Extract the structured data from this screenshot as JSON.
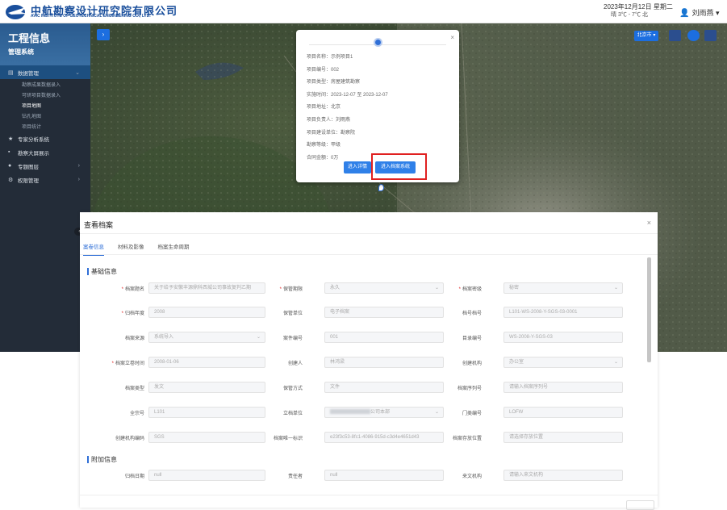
{
  "header": {
    "brand_cn": "中航勘察设计研究院有限公司",
    "brand_en": "AVIC INSTITUTE OF GEOTECHNICAL ENGINEERING CO., LTD.",
    "date": "2023年12月12日 星期二",
    "weather": "晴 3℃ - 7℃ 北",
    "user_name": "刘雨燕"
  },
  "sidebar": {
    "title": "工程信息",
    "subtitle": "管理系统",
    "items": [
      {
        "label": "数据管理",
        "type": "top",
        "active": true
      },
      {
        "label": "勘察成果数据录入",
        "type": "sub"
      },
      {
        "label": "可研项目数据录入",
        "type": "sub"
      },
      {
        "label": "项目地图",
        "type": "sub",
        "current": true
      },
      {
        "label": "钻孔地图",
        "type": "sub"
      },
      {
        "label": "项目统计",
        "type": "sub"
      },
      {
        "label": "专家分析系统",
        "type": "top"
      },
      {
        "label": "勘察大屏展示",
        "type": "top"
      },
      {
        "label": "专题图层",
        "type": "top",
        "arrow": true
      },
      {
        "label": "权限管理",
        "type": "top",
        "arrow": true
      }
    ]
  },
  "map": {
    "city_button": "北京市",
    "popup": {
      "rows": [
        "项目名称：示例项目1",
        "项目编号：002",
        "项目类型：房屋建筑勘察",
        "实施时间：2023-12-07 至 2023-12-07",
        "项目地址：北京",
        "项目负责人：刘雨燕",
        "项目建设单位：勘察院",
        "勘察等级：甲级",
        "合同金额：0万"
      ],
      "btn_portal": "进入详情",
      "btn_archive": "进入档案系统"
    }
  },
  "dialog": {
    "title": "查看档案",
    "tabs": [
      "案卷信息",
      "材料及影像",
      "档案生命周期"
    ],
    "section_basic": "基础信息",
    "section_extra": "附加信息",
    "fields": [
      {
        "label": "档案题名",
        "value": "关于给予安徽丰源鼎科西城公司事故复判乙期",
        "required": true,
        "col": 0,
        "row": 0
      },
      {
        "label": "保管期限",
        "value": "永久",
        "required": true,
        "col": 1,
        "row": 0,
        "dropdown": true
      },
      {
        "label": "档案密级",
        "value": "秘密",
        "required": true,
        "col": 2,
        "row": 0,
        "dropdown": true
      },
      {
        "label": "归档年度",
        "value": "2008",
        "required": true,
        "col": 0,
        "row": 1
      },
      {
        "label": "保管单位",
        "value": "电子档案",
        "col": 1,
        "row": 1
      },
      {
        "label": "档号档号",
        "value": "L101-WS-2008-Y-SGS-03-0001",
        "col": 2,
        "row": 1
      },
      {
        "label": "档案来源",
        "value": "系统导入",
        "col": 0,
        "row": 2,
        "dropdown": true
      },
      {
        "label": "案件编号",
        "value": "001",
        "col": 1,
        "row": 2
      },
      {
        "label": "目录编号",
        "value": "WS-2008-Y-SGS-03",
        "col": 2,
        "row": 2
      },
      {
        "label": "档案立卷时间",
        "value": "2008-01-06",
        "required": true,
        "col": 0,
        "row": 3
      },
      {
        "label": "创建人",
        "value": "林鸿梁",
        "col": 1,
        "row": 3
      },
      {
        "label": "创建机构",
        "value": "办公室",
        "col": 2,
        "row": 3,
        "dropdown": true
      },
      {
        "label": "档案类型",
        "value": "发文",
        "col": 0,
        "row": 4
      },
      {
        "label": "保管方式",
        "value": "文件",
        "col": 1,
        "row": 4
      },
      {
        "label": "档案序列号",
        "value": "请输入档案序列号",
        "col": 2,
        "row": 4
      },
      {
        "label": "全宗号",
        "value": "L101",
        "col": 0,
        "row": 5
      },
      {
        "label": "立档单位",
        "value": "公司本部",
        "col": 1,
        "row": 5,
        "dropdown": true,
        "blur": true
      },
      {
        "label": "门类编号",
        "value": "LOFW",
        "col": 2,
        "row": 5
      },
      {
        "label": "创建机构编码",
        "value": "SGS",
        "col": 0,
        "row": 6
      },
      {
        "label": "档案唯一标识",
        "value": "e23f3c53-8fc1-4086-915d-c3d4e4651d43",
        "col": 1,
        "row": 6
      },
      {
        "label": "档案存放位置",
        "value": "请选择存放位置",
        "col": 2,
        "row": 6
      },
      {
        "label": "归档日期",
        "value": "null",
        "col": 0,
        "row": 8
      },
      {
        "label": "责任者",
        "value": "null",
        "col": 1,
        "row": 8
      },
      {
        "label": "来文机构",
        "value": "请输入来文机构",
        "col": 2,
        "row": 8
      }
    ]
  }
}
